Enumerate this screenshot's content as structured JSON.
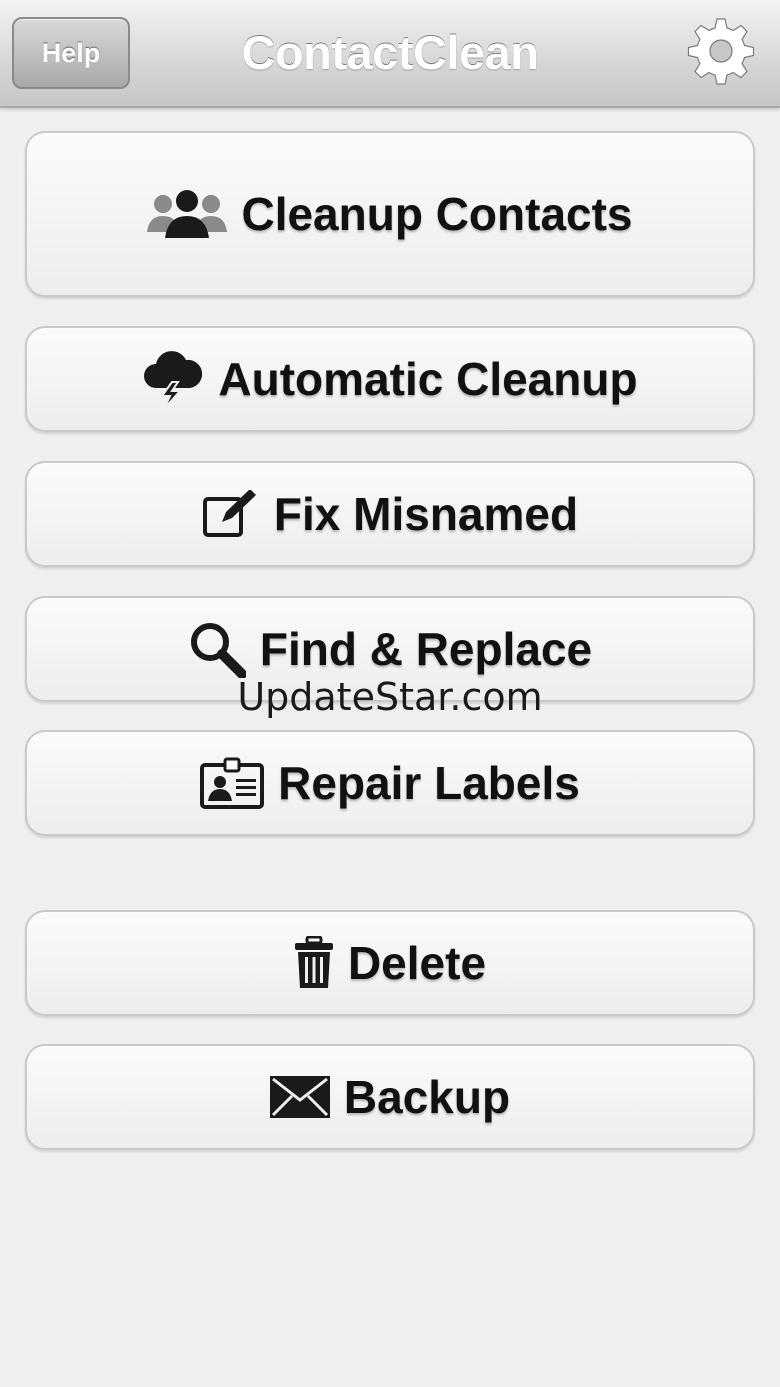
{
  "navbar": {
    "help_label": "Help",
    "title": "ContactClean",
    "settings_icon": "gear-icon"
  },
  "menu": {
    "cleanup_contacts": {
      "label": "Cleanup Contacts",
      "icon": "people-icon"
    },
    "automatic_cleanup": {
      "label": "Automatic Cleanup",
      "icon": "storm-cloud-icon"
    },
    "fix_misnamed": {
      "label": "Fix Misnamed",
      "icon": "edit-icon"
    },
    "find_replace": {
      "label": "Find & Replace",
      "icon": "magnifier-icon"
    },
    "repair_labels": {
      "label": "Repair Labels",
      "icon": "id-card-icon"
    },
    "delete": {
      "label": "Delete",
      "icon": "trash-icon"
    },
    "backup": {
      "label": "Backup",
      "icon": "envelope-icon"
    }
  },
  "watermark": "UpdateStar.com",
  "colors": {
    "background": "#efefef",
    "button_text": "#111111",
    "nav_text": "#ffffff"
  }
}
